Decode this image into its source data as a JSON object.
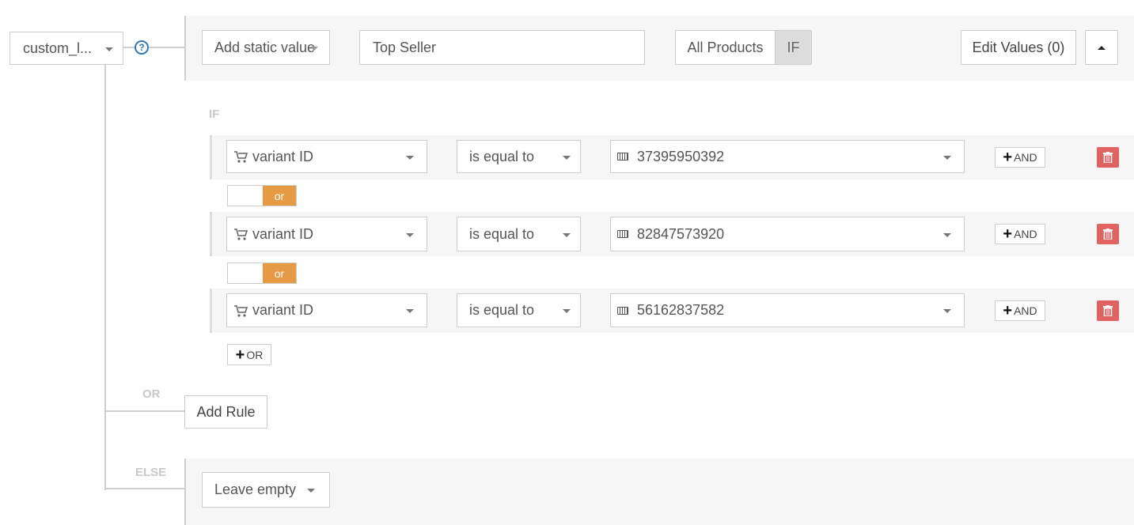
{
  "field_select": {
    "value": "custom_l..."
  },
  "help_icon": "question-circle-icon",
  "top_bar": {
    "value_source": "Add static value",
    "value_input": "Top Seller",
    "scope_toggle": {
      "left": "All Products",
      "right": "IF",
      "active": "IF"
    },
    "edit_values": "Edit Values (0)",
    "collapse_icon": "caret-up-icon"
  },
  "if_label": "IF",
  "conditions": [
    {
      "field": "variant ID",
      "operator": "is equal to",
      "value": "37395950392",
      "and_label": "AND"
    },
    {
      "field": "variant ID",
      "operator": "is equal to",
      "value": "82847573920",
      "and_label": "AND"
    },
    {
      "field": "variant ID",
      "operator": "is equal to",
      "value": "56162837582",
      "and_label": "AND"
    }
  ],
  "connectors": [
    {
      "label": "or"
    },
    {
      "label": "or"
    }
  ],
  "add_or_label": "OR",
  "or_label": "OR",
  "add_rule_label": "Add Rule",
  "else_label": "ELSE",
  "else_select": "Leave empty",
  "colors": {
    "accent_orange": "#e59a43",
    "delete_red": "#e06262",
    "help_blue": "#2a7ab8"
  }
}
